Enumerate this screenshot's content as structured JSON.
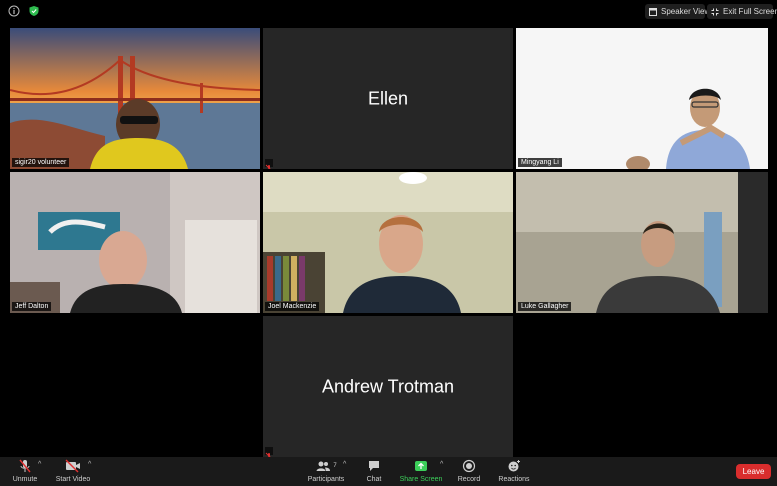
{
  "topbar": {
    "speaker_view_label": "Speaker View",
    "exit_fullscreen_label": "Exit Full Screen"
  },
  "participants": [
    {
      "name": "sigir20 volunteer"
    },
    {
      "name": "Ellen"
    },
    {
      "name": "Mingyang Li"
    },
    {
      "name": "Jeff Dalton"
    },
    {
      "name": "Joel Mackenzie"
    },
    {
      "name": "Luke Gallagher"
    },
    {
      "name": "Andrew Trotman"
    }
  ],
  "toolbar": {
    "unmute": "Unmute",
    "start_video": "Start Video",
    "participants": "Participants",
    "participants_count": "7",
    "chat": "Chat",
    "share_screen": "Share Screen",
    "record": "Record",
    "reactions": "Reactions",
    "leave": "Leave"
  },
  "colors": {
    "active_speaker_border": "#b7e344",
    "share_screen_green": "#3ccf5a",
    "leave_red": "#d92d2d"
  }
}
